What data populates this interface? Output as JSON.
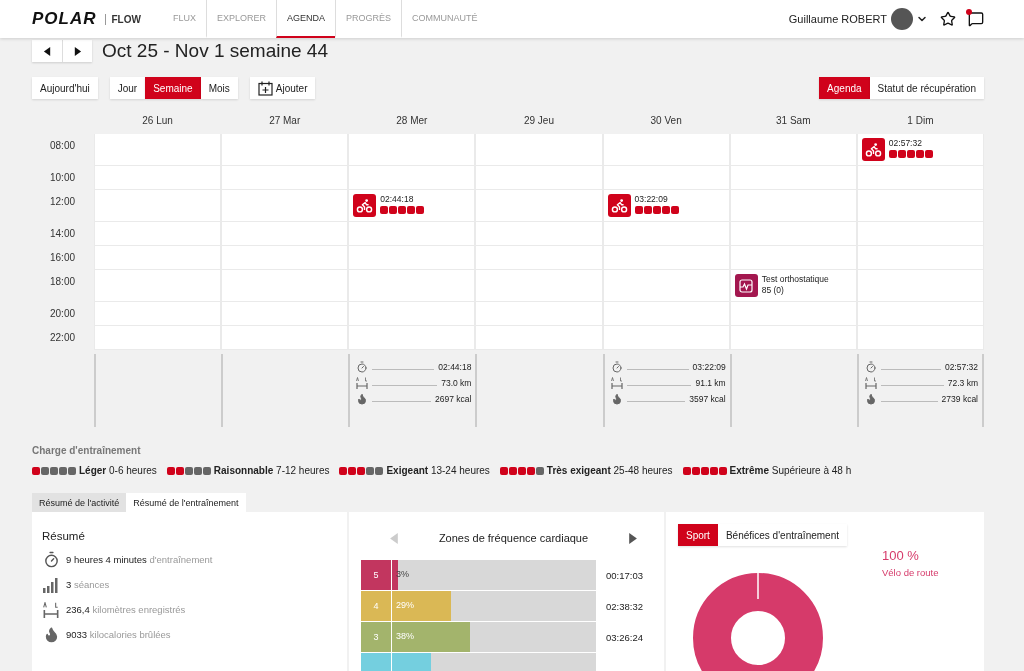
{
  "nav": {
    "logo": "POLAR",
    "product": "FLOW",
    "items": [
      {
        "label": "FLUX",
        "selected": false
      },
      {
        "label": "EXPLORER",
        "selected": false
      },
      {
        "label": "AGENDA",
        "selected": true
      },
      {
        "label": "PROGRÈS",
        "selected": false
      },
      {
        "label": "COMMUNAUTÉ",
        "selected": false
      }
    ],
    "user": "Guillaume ROBERT",
    "unread": true
  },
  "week": {
    "title": "Oct 25 - Nov 1 semaine 44"
  },
  "toolbar": {
    "today": "Aujourd'hui",
    "views": [
      {
        "label": "Jour",
        "selected": false
      },
      {
        "label": "Semaine",
        "selected": true
      },
      {
        "label": "Mois",
        "selected": false
      }
    ],
    "add": "Ajouter",
    "modes": [
      {
        "label": "Agenda",
        "selected": true
      },
      {
        "label": "Statut de récupération",
        "selected": false
      }
    ]
  },
  "calendar": {
    "days": [
      "26 Lun",
      "27 Mar",
      "28 Mer",
      "29 Jeu",
      "30 Ven",
      "31 Sam",
      "1 Dim"
    ],
    "rows": [
      {
        "time": "08:00",
        "cells": [
          {
            "kind": "empty"
          },
          {
            "kind": "empty"
          },
          {
            "kind": "empty"
          },
          {
            "kind": "empty"
          },
          {
            "kind": "empty"
          },
          {
            "kind": "empty"
          },
          {
            "kind": "training",
            "duration": "02:57:32",
            "stars": 5
          }
        ]
      },
      {
        "time": "10:00",
        "cells": [
          {
            "kind": "empty"
          },
          {
            "kind": "empty"
          },
          {
            "kind": "empty"
          },
          {
            "kind": "empty"
          },
          {
            "kind": "empty"
          },
          {
            "kind": "empty"
          },
          {
            "kind": "empty"
          }
        ]
      },
      {
        "time": "12:00",
        "cells": [
          {
            "kind": "empty"
          },
          {
            "kind": "empty"
          },
          {
            "kind": "training",
            "duration": "02:44:18",
            "stars": 5
          },
          {
            "kind": "empty"
          },
          {
            "kind": "training",
            "duration": "03:22:09",
            "stars": 5
          },
          {
            "kind": "empty"
          },
          {
            "kind": "empty"
          }
        ]
      },
      {
        "time": "14:00",
        "cells": [
          {
            "kind": "empty"
          },
          {
            "kind": "empty"
          },
          {
            "kind": "empty"
          },
          {
            "kind": "empty"
          },
          {
            "kind": "empty"
          },
          {
            "kind": "empty"
          },
          {
            "kind": "empty"
          }
        ]
      },
      {
        "time": "16:00",
        "cells": [
          {
            "kind": "empty"
          },
          {
            "kind": "empty"
          },
          {
            "kind": "empty"
          },
          {
            "kind": "empty"
          },
          {
            "kind": "empty"
          },
          {
            "kind": "empty"
          },
          {
            "kind": "empty"
          }
        ]
      },
      {
        "time": "18:00",
        "cells": [
          {
            "kind": "empty"
          },
          {
            "kind": "empty"
          },
          {
            "kind": "empty"
          },
          {
            "kind": "empty"
          },
          {
            "kind": "empty"
          },
          {
            "kind": "test",
            "name": "Test orthostatique",
            "result": "85 (0)"
          },
          {
            "kind": "empty"
          }
        ]
      },
      {
        "time": "20:00",
        "cells": [
          {
            "kind": "empty"
          },
          {
            "kind": "empty"
          },
          {
            "kind": "empty"
          },
          {
            "kind": "empty"
          },
          {
            "kind": "empty"
          },
          {
            "kind": "empty"
          },
          {
            "kind": "empty"
          }
        ]
      },
      {
        "time": "22:00",
        "cells": [
          {
            "kind": "empty"
          },
          {
            "kind": "empty"
          },
          {
            "kind": "empty"
          },
          {
            "kind": "empty"
          },
          {
            "kind": "empty"
          },
          {
            "kind": "empty"
          },
          {
            "kind": "empty"
          }
        ]
      }
    ],
    "totals": [
      {
        "kind": "empty"
      },
      {
        "kind": "empty"
      },
      {
        "kind": "totals",
        "duration": "02:44:18",
        "distance": "73.0 km",
        "calories": "2697 kcal"
      },
      {
        "kind": "empty"
      },
      {
        "kind": "totals",
        "duration": "03:22:09",
        "distance": "91.1 km",
        "calories": "3597 kcal"
      },
      {
        "kind": "empty"
      },
      {
        "kind": "totals",
        "duration": "02:57:32",
        "distance": "72.3 km",
        "calories": "2739 kcal"
      }
    ]
  },
  "load_legend": {
    "title": "Charge d'entraînement",
    "items": [
      {
        "text": "**Léger** 0-6 heures",
        "stars": 1
      },
      {
        "text": "**Raisonnable** 7-12 heures",
        "stars": 2
      },
      {
        "text": "**Exigeant** 13-24 heures",
        "stars": 3
      },
      {
        "text": "**Très exigeant** 25-48 heures",
        "stars": 4
      },
      {
        "text": "**Extrême** Supérieure à 48 h",
        "stars": 5
      }
    ]
  },
  "tabs": [
    {
      "label": "Résumé de l'activité",
      "selected": false
    },
    {
      "label": "Résumé de l'entraînement",
      "selected": true
    }
  ],
  "summary": {
    "title": "Résumé",
    "items": [
      {
        "kind": "duration",
        "value": "9 heures 4 minutes",
        "label": "d'entraînement"
      },
      {
        "kind": "sessions",
        "value": "3",
        "label": "séances"
      },
      {
        "kind": "distance",
        "value": "236,4",
        "label": "kilomètres enregistrés"
      },
      {
        "kind": "calories",
        "value": "9033",
        "label": "kilocalories brûlées"
      }
    ]
  },
  "zones": {
    "title": "Zones de fréquence cardiaque",
    "prev_disabled": true,
    "next_disabled": false,
    "zones": [
      {
        "zone": "5",
        "percent": "3%",
        "time": "00:17:03",
        "level": 0.03,
        "color": "#c2365f"
      },
      {
        "zone": "4",
        "percent": "29%",
        "time": "02:38:32",
        "level": 0.29,
        "color": "#dab855"
      },
      {
        "zone": "3",
        "percent": "38%",
        "time": "03:26:24",
        "level": 0.38,
        "color": "#a3b46c"
      },
      {
        "level": 0.19,
        "color": "#74cfdf"
      }
    ]
  },
  "sport": {
    "tabs": [
      {
        "label": "Sport",
        "selected": true
      },
      {
        "label": "Bénéfices d'entraînement",
        "selected": false
      }
    ],
    "share": "100 %",
    "name": "Vélo de route"
  }
}
